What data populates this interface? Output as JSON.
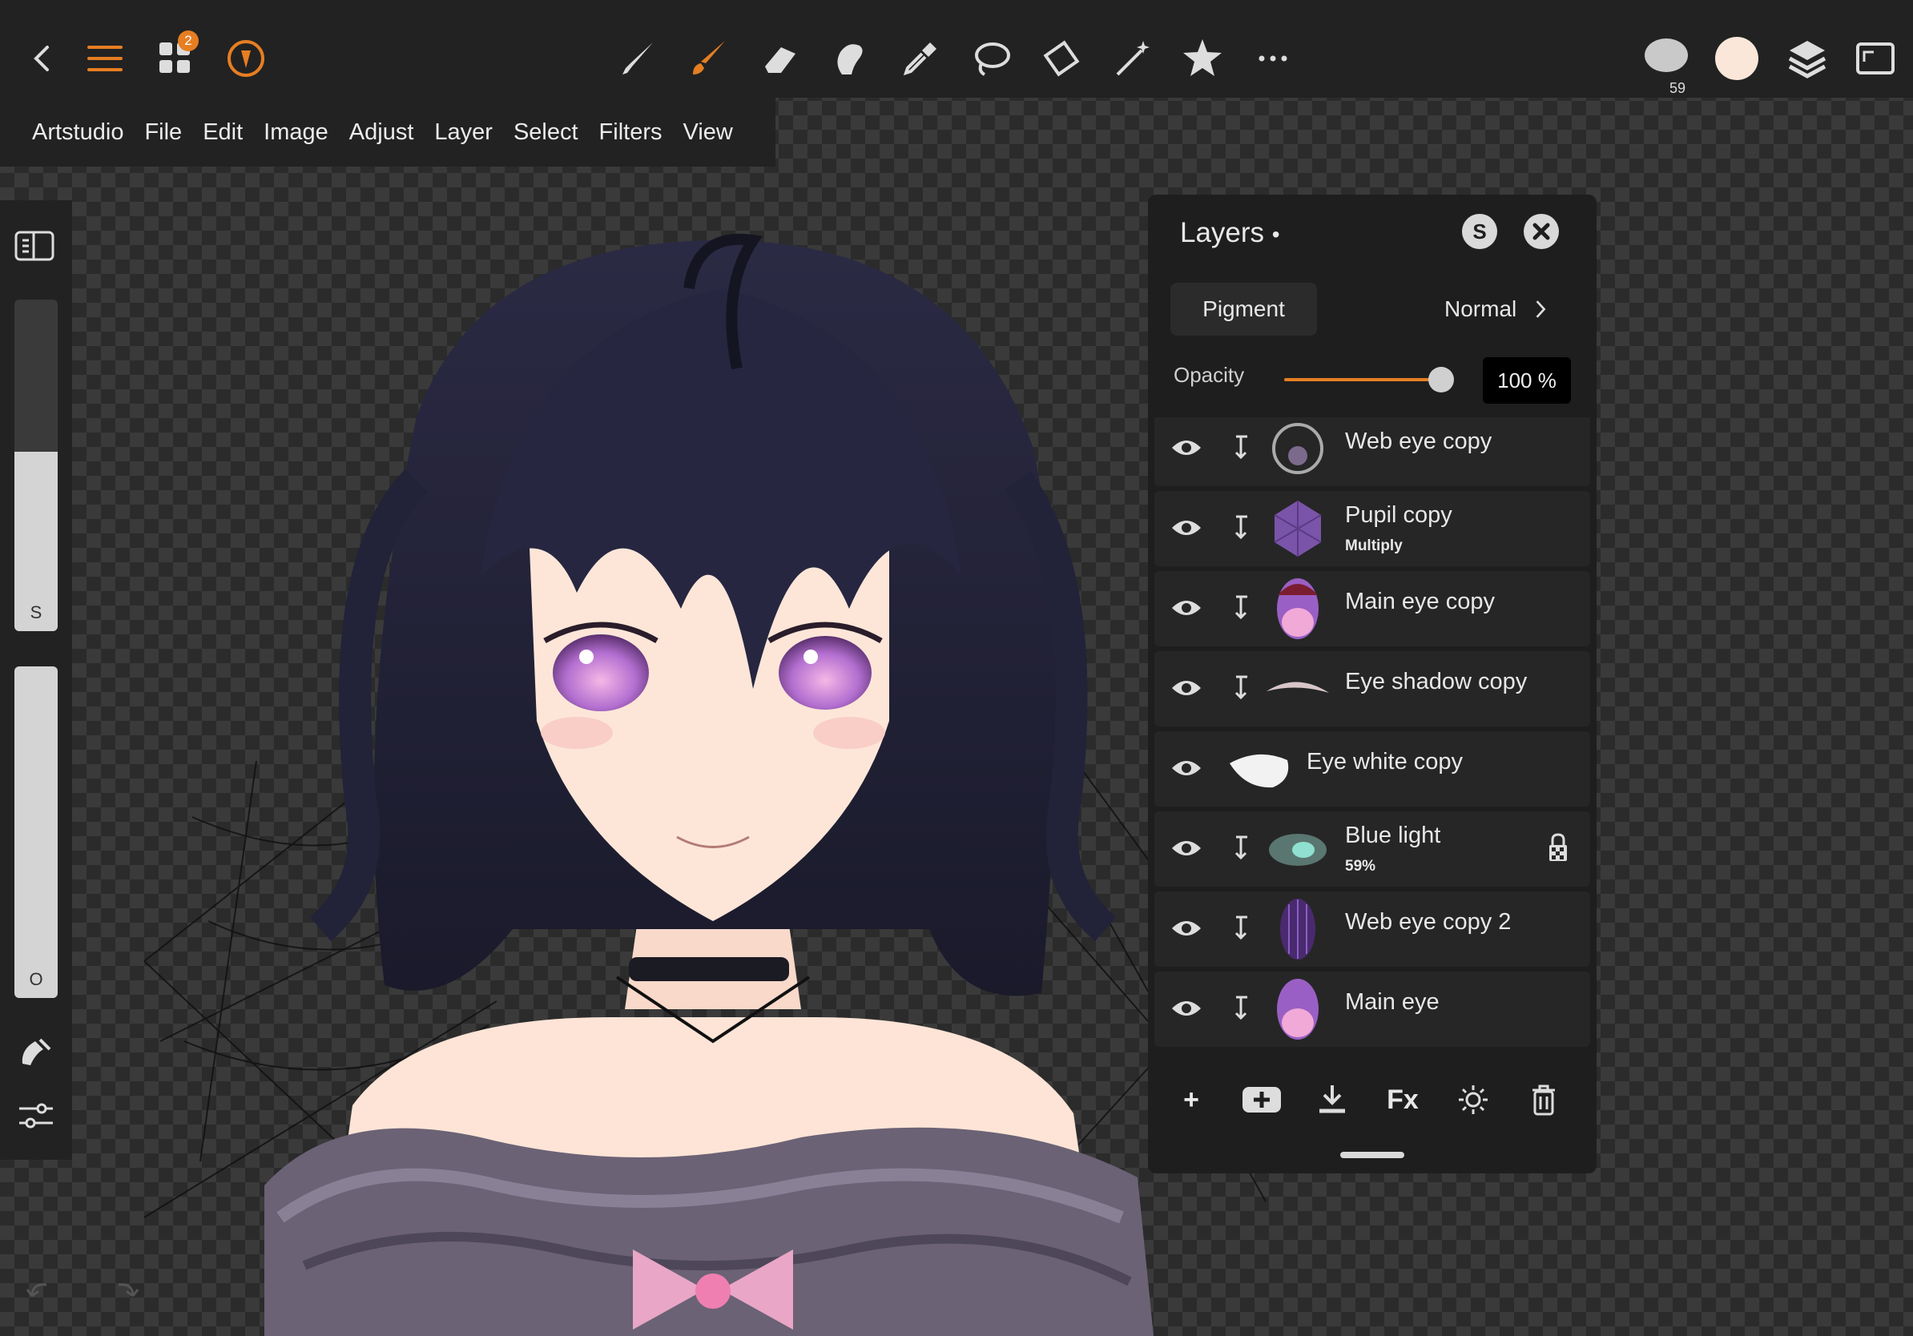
{
  "toolbar": {
    "apps_badge": "2",
    "brush_size": "59",
    "tools": [
      "brush-tool",
      "paint-brush-tool",
      "eraser-tool",
      "smudge-tool",
      "eyedropper-tool",
      "lasso-tool",
      "transform-tool",
      "magic-wand-tool",
      "favorites-tool",
      "more-tools"
    ],
    "accent_color": "#e67e22",
    "primary_color": "#fbe7d9",
    "secondary_color": "#c9c9c9"
  },
  "menu": [
    "Artstudio",
    "File",
    "Edit",
    "Image",
    "Adjust",
    "Layer",
    "Select",
    "Filters",
    "View"
  ],
  "leftbar": {
    "size_label": "S",
    "opacity_label": "O",
    "size_level": 0.54,
    "opacity_level": 1.0
  },
  "layers_panel": {
    "title": "Layers",
    "title_dot": "•",
    "s_button": "S",
    "pigment_button": "Pigment",
    "blend_mode": "Normal",
    "opacity_label": "Opacity",
    "opacity_value": "100 %",
    "opacity_level": 1.0,
    "layers": [
      {
        "name": "Web eye copy",
        "sub": "",
        "clipped": true
      },
      {
        "name": "Pupil copy",
        "sub": "Multiply",
        "clipped": true
      },
      {
        "name": "Main eye copy",
        "sub": "",
        "clipped": true
      },
      {
        "name": "Eye shadow copy",
        "sub": "",
        "clipped": true
      },
      {
        "name": "Eye white copy",
        "sub": "",
        "clipped": false
      },
      {
        "name": "Blue light",
        "sub": "59%",
        "clipped": true,
        "locked": true
      },
      {
        "name": "Web eye copy 2",
        "sub": "",
        "clipped": true
      },
      {
        "name": "Main eye",
        "sub": "",
        "clipped": true
      }
    ],
    "footer": {
      "add": "+",
      "fx": "Fx"
    }
  }
}
